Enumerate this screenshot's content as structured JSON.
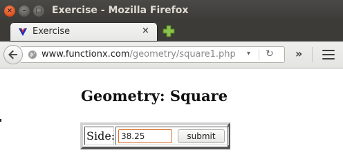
{
  "window": {
    "title": "Exercise - Mozilla Firefox",
    "controls": {
      "close": "×",
      "minimize": "–",
      "maximize": "□"
    }
  },
  "tabs": [
    {
      "label": "Exercise",
      "close": "×",
      "favicon": "functionx-v-icon"
    }
  ],
  "new_tab_icon": "plus-icon",
  "navbar": {
    "back_icon": "back-arrow-icon",
    "url_host": "www.functionx.com",
    "url_path": "/geometry/square1.php",
    "dropdown_glyph": "▾",
    "reload_glyph": "↻",
    "overflow_glyph": "»",
    "menu_icon": "hamburger-icon"
  },
  "page": {
    "heading": "Geometry: Square",
    "form": {
      "side_label": "Side:",
      "side_value": "38.25",
      "submit_label": "submit"
    }
  },
  "colors": {
    "titlebar": "#3c3b37",
    "close_button": "#df4b16",
    "focus_border": "#d56c2c",
    "favicon_blue": "#1a2fb0",
    "favicon_red": "#d8201c",
    "plus_green": "#8bc34a"
  }
}
